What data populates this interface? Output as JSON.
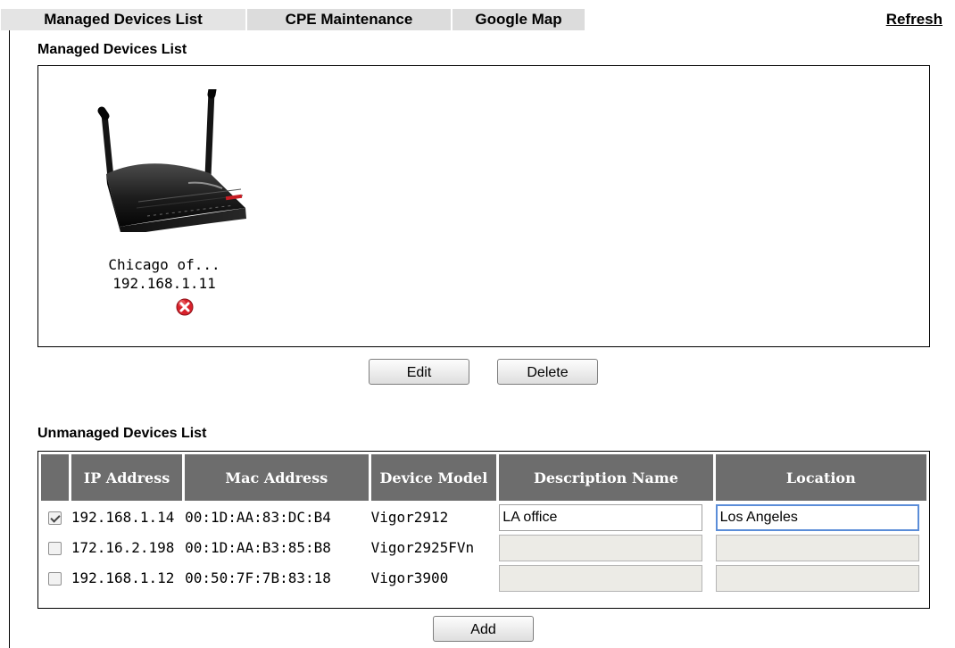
{
  "tabs": [
    {
      "label": "Managed Devices List"
    },
    {
      "label": "CPE Maintenance"
    },
    {
      "label": "Google Map"
    }
  ],
  "refresh_label": "Refresh",
  "managed": {
    "heading": "Managed Devices List",
    "devices": [
      {
        "name": "Chicago of...",
        "ip": "192.168.1.11",
        "status_icon": "error-icon"
      }
    ],
    "edit_label": "Edit",
    "delete_label": "Delete"
  },
  "unmanaged": {
    "heading": "Unmanaged Devices List",
    "columns": {
      "ip": "IP Address",
      "mac": "Mac Address",
      "model": "Device Model",
      "description": "Description Name",
      "location": "Location"
    },
    "rows": [
      {
        "checked": true,
        "ip": "192.168.1.14",
        "mac": "00:1D:AA:83:DC:B4",
        "model": "Vigor2912",
        "description": "LA office",
        "location": "Los Angeles"
      },
      {
        "checked": false,
        "ip": "172.16.2.198",
        "mac": "00:1D:AA:B3:85:B8",
        "model": "Vigor2925FVn",
        "description": "",
        "location": ""
      },
      {
        "checked": false,
        "ip": "192.168.1.12",
        "mac": "00:50:7F:7B:83:18",
        "model": "Vigor3900",
        "description": "",
        "location": ""
      }
    ],
    "add_label": "Add"
  },
  "colors": {
    "tab_background": "#dcdcdc",
    "table_header": "#6d6d6d",
    "error": "#d8222b"
  }
}
